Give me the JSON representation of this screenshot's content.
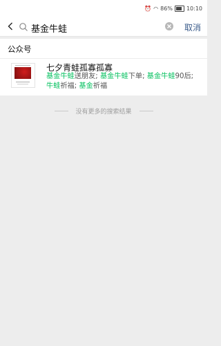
{
  "status_bar": {
    "battery": "86%",
    "time": "10:10"
  },
  "search": {
    "query": "基金牛蛙",
    "cancel_label": "取消"
  },
  "section": {
    "title": "公众号"
  },
  "result": {
    "title": "七夕青蛙孤寡孤寡",
    "desc_parts": [
      {
        "text": "基金牛蛙",
        "highlight": true
      },
      {
        "text": "送朋友; ",
        "highlight": false
      },
      {
        "text": "基金牛蛙",
        "highlight": true
      },
      {
        "text": "下单; ",
        "highlight": false
      },
      {
        "text": "基金牛蛙",
        "highlight": true
      },
      {
        "text": "90后; ",
        "highlight": false
      },
      {
        "text": "牛蛙",
        "highlight": true
      },
      {
        "text": "祈福; ",
        "highlight": false
      },
      {
        "text": "基金",
        "highlight": true
      },
      {
        "text": "祈福",
        "highlight": false
      }
    ]
  },
  "footer": {
    "text": "没有更多的搜索结果"
  },
  "colors": {
    "highlight": "#07c160",
    "cancel": "#3a5b8a",
    "background": "#ededed"
  }
}
